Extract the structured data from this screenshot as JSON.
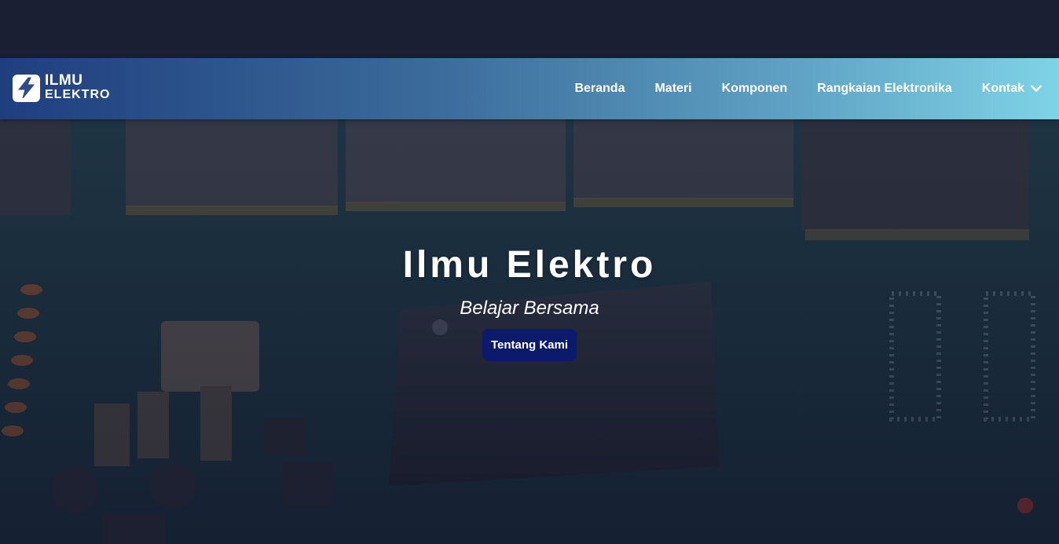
{
  "brand": {
    "line1": "ILMU",
    "line2": "ELEKTRO",
    "logo_icon": "lightning-bolt-icon"
  },
  "nav": {
    "items": [
      {
        "label": "Beranda"
      },
      {
        "label": "Materi"
      },
      {
        "label": "Komponen"
      },
      {
        "label": "Rangkaian Elektronika"
      },
      {
        "label": "Kontak",
        "icon": "chevron-down-icon"
      }
    ]
  },
  "hero": {
    "title": "Ilmu Elektro",
    "subtitle": "Belajar Bersama",
    "cta_label": "Tentang Kami",
    "background": "circuit-board-photo"
  },
  "colors": {
    "cta": "#0c1a6e",
    "navbar_start": "#1f3e7e",
    "navbar_end": "#7fd3e6",
    "topbar": "#1b1f33"
  }
}
